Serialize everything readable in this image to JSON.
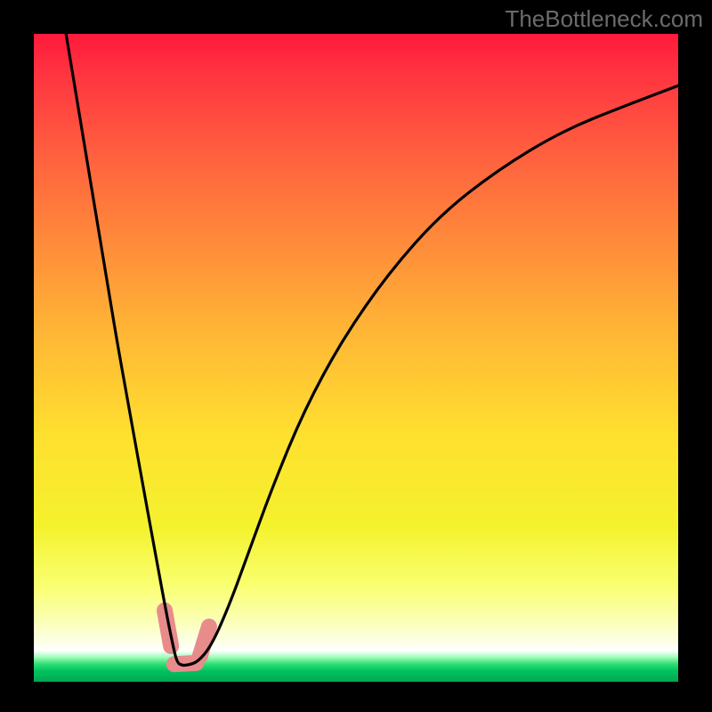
{
  "watermark": "TheBottleneck.com",
  "colors": {
    "frame": "#000000",
    "curve": "#000000",
    "highlight": "#e88b8b",
    "gradient_top": "#ff1a3b",
    "gradient_bottom": "#00a851"
  },
  "chart_data": {
    "type": "line",
    "title": "",
    "xlabel": "",
    "ylabel": "",
    "xlim": [
      0,
      100
    ],
    "ylim": [
      0,
      100
    ],
    "note": "Notch / bottleneck curve on a red→green vertical gradient. Values are estimated from pixel positions; axes are unlabeled in the source image so units are 0–100 normalized.",
    "series": [
      {
        "name": "bottleneck-curve",
        "x": [
          5,
          7,
          9,
          11,
          13,
          15,
          17,
          19,
          20.5,
          21.5,
          22.2,
          23.0,
          24.0,
          25.5,
          27.5,
          30,
          33,
          37,
          42,
          48,
          55,
          63,
          72,
          82,
          92,
          100
        ],
        "y": [
          100,
          88,
          76,
          64,
          52,
          41,
          30,
          19,
          11,
          6,
          3.0,
          2.5,
          2.6,
          3.1,
          5.5,
          11,
          19,
          30,
          42,
          53,
          63,
          72,
          79,
          85,
          89,
          92
        ]
      }
    ],
    "highlight_segments": [
      {
        "name": "left-wall",
        "x": [
          20.3,
          21.3
        ],
        "y": [
          11.0,
          5.5
        ]
      },
      {
        "name": "floor",
        "x": [
          21.8,
          25.2
        ],
        "y": [
          2.7,
          2.9
        ]
      },
      {
        "name": "right-wall",
        "x": [
          25.8,
          27.2
        ],
        "y": [
          4.0,
          8.5
        ]
      }
    ]
  }
}
